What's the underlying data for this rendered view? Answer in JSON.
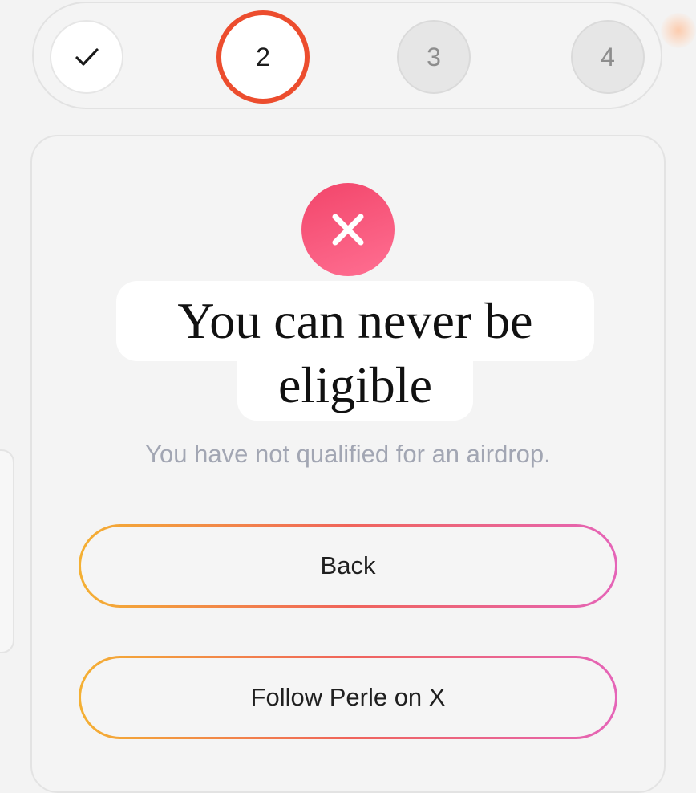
{
  "stepper": {
    "steps": [
      {
        "label": "",
        "state": "completed",
        "icon": "check-icon"
      },
      {
        "label": "2",
        "state": "current"
      },
      {
        "label": "3",
        "state": "upcoming"
      },
      {
        "label": "4",
        "state": "upcoming"
      }
    ],
    "current_ring_color": "#ec4d2e"
  },
  "result": {
    "icon": "close-icon",
    "icon_color": "#f2456a",
    "title_line1": "You can never be",
    "title_line2": "eligible",
    "subtitle": "You have not qualified for an airdrop."
  },
  "actions": {
    "back_label": "Back",
    "follow_label": "Follow Perle on X",
    "border_gradient": [
      "#f4b033",
      "#f0645a",
      "#e564b8"
    ]
  }
}
